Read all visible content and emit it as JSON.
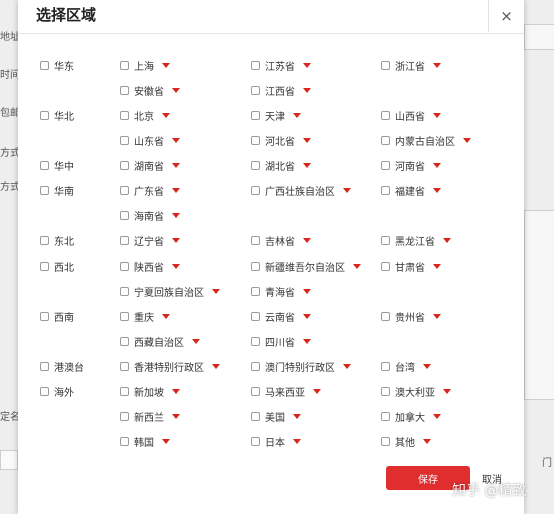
{
  "background": {
    "labels": [
      "地址",
      "时间",
      "包邮",
      "方式",
      "方式",
      "定名"
    ],
    "right_fragment": "门"
  },
  "modal": {
    "title": "选择区域",
    "close_symbol": "×",
    "save_label": "保存",
    "cancel_label": "取消"
  },
  "regions": [
    {
      "label": "华东",
      "rows": [
        [
          "上海",
          "江苏省",
          "浙江省"
        ],
        [
          "安徽省",
          "江西省"
        ]
      ]
    },
    {
      "label": "华北",
      "rows": [
        [
          "北京",
          "天津",
          "山西省"
        ],
        [
          "山东省",
          "河北省",
          "内蒙古自治区"
        ]
      ]
    },
    {
      "label": "华中",
      "rows": [
        [
          "湖南省",
          "湖北省",
          "河南省"
        ]
      ]
    },
    {
      "label": "华南",
      "rows": [
        [
          "广东省",
          "广西壮族自治区",
          "福建省"
        ],
        [
          "海南省"
        ]
      ]
    },
    {
      "label": "东北",
      "rows": [
        [
          "辽宁省",
          "吉林省",
          "黑龙江省"
        ]
      ]
    },
    {
      "label": "西北",
      "rows": [
        [
          "陕西省",
          "新疆维吾尔自治区",
          "甘肃省"
        ],
        [
          "宁夏回族自治区",
          "青海省"
        ]
      ]
    },
    {
      "label": "西南",
      "rows": [
        [
          "重庆",
          "云南省",
          "贵州省"
        ],
        [
          "西藏自治区",
          "四川省"
        ]
      ]
    },
    {
      "label": "港澳台",
      "rows": [
        [
          "香港特别行政区",
          "澳门特别行政区",
          "台湾"
        ]
      ]
    },
    {
      "label": "海外",
      "rows": [
        [
          "新加坡",
          "马来西亚",
          "澳大利亚"
        ],
        [
          "新西兰",
          "美国",
          "加拿大"
        ],
        [
          "韩国",
          "日本",
          "其他"
        ]
      ]
    }
  ],
  "watermark": "知乎 @精致",
  "colors": {
    "accent": "#e02e2e",
    "caret": "#d9261c",
    "overlay": "#eeeeee"
  }
}
